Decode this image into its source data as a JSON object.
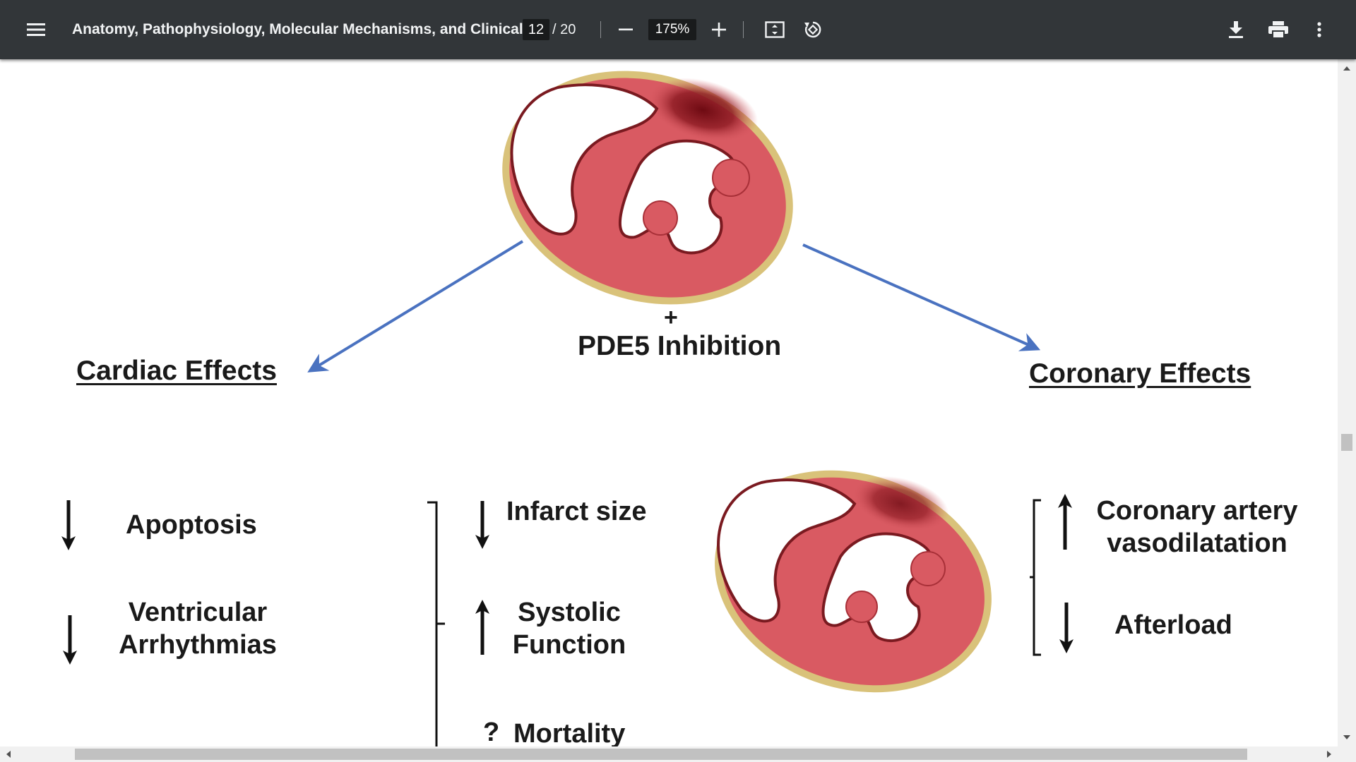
{
  "toolbar": {
    "title": "Anatomy, Pathophysiology, Molecular Mechanisms, and Clinical...",
    "current_page": "12",
    "page_separator": "/",
    "total_pages": "20",
    "zoom": "175%",
    "icons": [
      "menu-icon",
      "zoom-out-icon",
      "zoom-in-icon",
      "fit-page-icon",
      "rotate-icon",
      "download-icon",
      "print-icon",
      "more-vert-icon"
    ]
  },
  "figure": {
    "plus": "+",
    "center_label": "PDE5 Inhibition",
    "left_heading": "Cardiac Effects",
    "right_heading": "Coronary Effects",
    "cardiac": {
      "apoptosis": "Apoptosis",
      "ventricular_line1": "Ventricular",
      "ventricular_line2": "Arrhythmias"
    },
    "middle": {
      "infarct": "Infarct size",
      "systolic_line1": "Systolic",
      "systolic_line2": "Function",
      "mortality_mark": "?",
      "mortality": "Mortality"
    },
    "coronary": {
      "vaso_line1": "Coronary artery",
      "vaso_line2": "vasodilatation",
      "afterload": "Afterload"
    },
    "colors": {
      "arrow_blue": "#4a72c0",
      "myocardium": "#d95a62",
      "infarct": "#7a0f16",
      "pericardium": "#d9c27a"
    }
  }
}
